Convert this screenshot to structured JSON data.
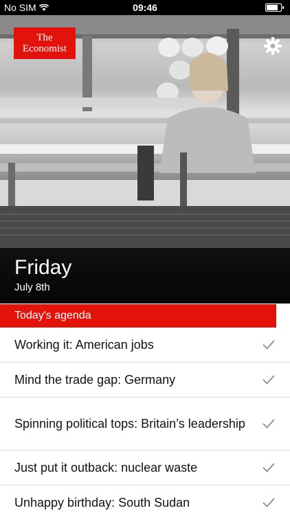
{
  "status": {
    "carrier": "No SIM",
    "time": "09:46"
  },
  "brand": {
    "logo_line1": "The",
    "logo_line2": "Economist",
    "accent_color": "#e3120b"
  },
  "hero": {
    "day": "Friday",
    "date": "July 8th",
    "settings_icon": "gear-icon"
  },
  "agenda": {
    "header": "Today's agenda",
    "items": [
      {
        "label": "Working it: American jobs"
      },
      {
        "label": "Mind the trade gap: Germany"
      },
      {
        "label": "Spinning political tops: Britain’s leadership"
      },
      {
        "label": "Just put it outback: nuclear waste"
      },
      {
        "label": "Unhappy birthday: South Sudan"
      }
    ]
  }
}
